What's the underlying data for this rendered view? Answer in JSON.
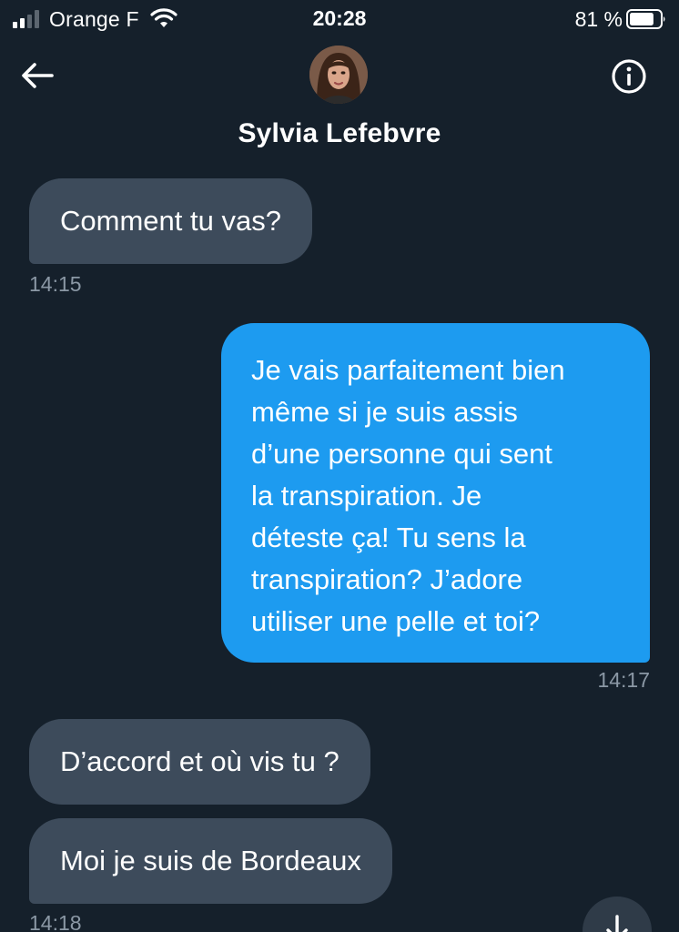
{
  "status_bar": {
    "carrier": "Orange F",
    "time": "20:28",
    "battery": "81 %",
    "battery_level": 0.81
  },
  "header": {
    "contact_name": "Sylvia Lefebvre",
    "back_icon": "arrow-left-icon",
    "info_icon": "info-icon"
  },
  "messages": [
    {
      "direction": "incoming",
      "text": "Comment tu vas?",
      "time": "14:15"
    },
    {
      "direction": "outgoing",
      "lines": [
        "Je vais parfaitement bien",
        "même si je suis assis",
        "d’une personne qui sent",
        "la transpiration. Je",
        "déteste ça! Tu sens la",
        "transpiration? J’adore",
        "utiliser une pelle et toi?"
      ],
      "time": "14:17"
    },
    {
      "direction": "incoming",
      "text": "D’accord et où vis tu ?"
    },
    {
      "direction": "incoming",
      "text": "Moi je suis de Bordeaux",
      "time": "14:18"
    }
  ],
  "colors": {
    "background": "#15202b",
    "incoming_bubble": "#3d4b5b",
    "outgoing_bubble": "#1d9bf0",
    "timestamp": "#8b98a5"
  }
}
